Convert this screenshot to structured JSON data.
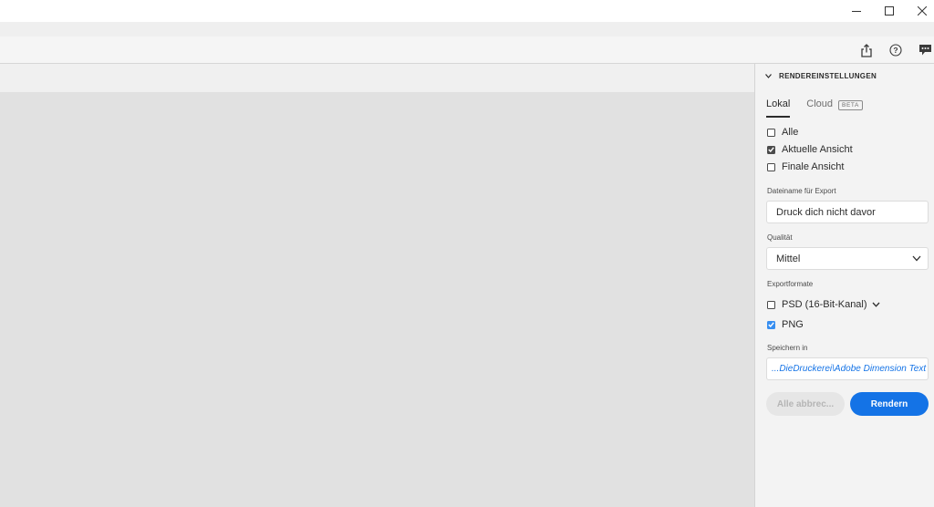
{
  "window": {
    "minimize_icon": "minimize-icon",
    "maximize_icon": "maximize-icon",
    "close_icon": "close-icon"
  },
  "toolbar": {
    "icons": [
      "share-icon",
      "help-icon",
      "feedback-icon"
    ]
  },
  "panel": {
    "title": "RENDEREINSTELLUNGEN",
    "tabs": [
      {
        "label": "Lokal",
        "active": true
      },
      {
        "label": "Cloud",
        "badge": "BETA",
        "active": false
      }
    ],
    "view_options": [
      {
        "label": "Alle",
        "checked": false
      },
      {
        "label": "Aktuelle Ansicht",
        "checked": true
      },
      {
        "label": "Finale Ansicht",
        "checked": false
      }
    ],
    "filename": {
      "label": "Dateiname für Export",
      "value": "Druck dich nicht davor"
    },
    "quality": {
      "label": "Qualität",
      "value": "Mittel"
    },
    "formats": {
      "label": "Exportformate",
      "items": [
        {
          "label": "PSD (16-Bit-Kanal)",
          "checked": false
        },
        {
          "label": "PNG",
          "checked": true
        }
      ]
    },
    "save_in": {
      "label": "Speichern in",
      "value": "...DieDruckerei\\Adobe Dimension Text"
    },
    "cancel_all_label": "Alle abbrec...",
    "render_label": "Rendern"
  },
  "colors": {
    "accent": "#1473e6",
    "checkbox_blue": "#378ef0",
    "canvas": "#e1e1e1",
    "panel": "#f3f3f3"
  }
}
